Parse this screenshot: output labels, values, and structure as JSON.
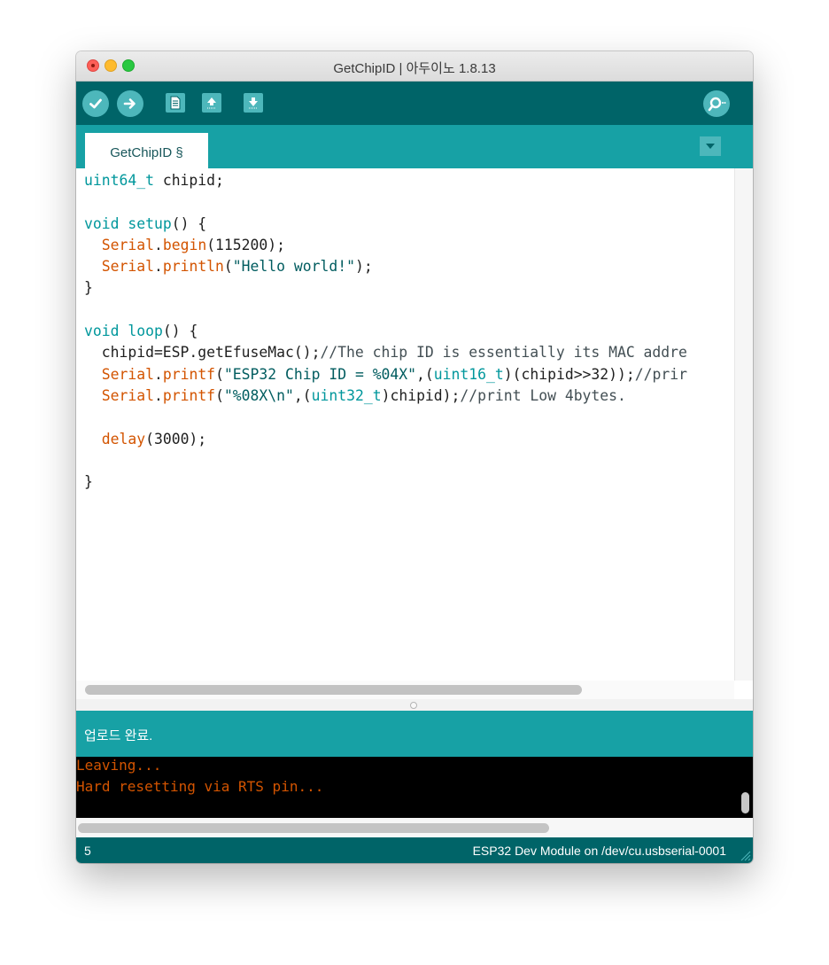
{
  "window": {
    "title": "GetChipID | 아두이노 1.8.13"
  },
  "toolbar": {
    "buttons": [
      {
        "name": "verify",
        "icon": "checkmark-icon"
      },
      {
        "name": "upload",
        "icon": "right-arrow-icon"
      },
      {
        "name": "new",
        "icon": "document-icon"
      },
      {
        "name": "open",
        "icon": "up-arrow-icon"
      },
      {
        "name": "save",
        "icon": "down-arrow-icon"
      },
      {
        "name": "serial-monitor",
        "icon": "magnifier-icon"
      }
    ]
  },
  "tabs": [
    {
      "label": "GetChipID §"
    }
  ],
  "editor": {
    "lines": [
      [
        {
          "t": "uint64_t",
          "c": "kw"
        },
        {
          "t": " chipid;",
          "c": ""
        }
      ],
      [],
      [
        {
          "t": "void",
          "c": "kw"
        },
        {
          "t": " ",
          "c": ""
        },
        {
          "t": "setup",
          "c": "kw"
        },
        {
          "t": "() {",
          "c": ""
        }
      ],
      [
        {
          "t": "  ",
          "c": ""
        },
        {
          "t": "Serial",
          "c": "fn"
        },
        {
          "t": ".",
          "c": ""
        },
        {
          "t": "begin",
          "c": "fn"
        },
        {
          "t": "(115200);",
          "c": ""
        }
      ],
      [
        {
          "t": "  ",
          "c": ""
        },
        {
          "t": "Serial",
          "c": "fn"
        },
        {
          "t": ".",
          "c": ""
        },
        {
          "t": "println",
          "c": "fn"
        },
        {
          "t": "(",
          "c": ""
        },
        {
          "t": "\"Hello world!\"",
          "c": "st"
        },
        {
          "t": ");",
          "c": ""
        }
      ],
      [
        {
          "t": "}",
          "c": ""
        }
      ],
      [],
      [
        {
          "t": "void",
          "c": "kw"
        },
        {
          "t": " ",
          "c": ""
        },
        {
          "t": "loop",
          "c": "kw"
        },
        {
          "t": "() {",
          "c": ""
        }
      ],
      [
        {
          "t": "  chipid=ESP.getEfuseMac();",
          "c": ""
        },
        {
          "t": "//The chip ID is essentially its MAC addre",
          "c": "cm"
        }
      ],
      [
        {
          "t": "  ",
          "c": ""
        },
        {
          "t": "Serial",
          "c": "fn"
        },
        {
          "t": ".",
          "c": ""
        },
        {
          "t": "printf",
          "c": "fn"
        },
        {
          "t": "(",
          "c": ""
        },
        {
          "t": "\"ESP32 Chip ID = %04X\"",
          "c": "st"
        },
        {
          "t": ",(",
          "c": ""
        },
        {
          "t": "uint16_t",
          "c": "kw"
        },
        {
          "t": ")(chipid>>32));",
          "c": ""
        },
        {
          "t": "//prir",
          "c": "cm"
        }
      ],
      [
        {
          "t": "  ",
          "c": ""
        },
        {
          "t": "Serial",
          "c": "fn"
        },
        {
          "t": ".",
          "c": ""
        },
        {
          "t": "printf",
          "c": "fn"
        },
        {
          "t": "(",
          "c": ""
        },
        {
          "t": "\"%08X\\n\"",
          "c": "st"
        },
        {
          "t": ",(",
          "c": ""
        },
        {
          "t": "uint32_t",
          "c": "kw"
        },
        {
          "t": ")chipid);",
          "c": ""
        },
        {
          "t": "//print Low 4bytes.",
          "c": "cm"
        }
      ],
      [],
      [
        {
          "t": "  ",
          "c": ""
        },
        {
          "t": "delay",
          "c": "fn"
        },
        {
          "t": "(3000);",
          "c": ""
        }
      ],
      [],
      [
        {
          "t": "}",
          "c": ""
        }
      ]
    ]
  },
  "status": {
    "message": "업로드 완료."
  },
  "console": {
    "lines": [
      "Leaving...",
      "Hard resetting via RTS pin..."
    ]
  },
  "footer": {
    "line_number": "5",
    "board": "ESP32 Dev Module on /dev/cu.usbserial-0001"
  },
  "colors": {
    "toolbar": "#006468",
    "tabbar": "#17a1a5",
    "button": "#4db7bb",
    "keyword": "#00979c",
    "function": "#d35400",
    "string": "#005c5f",
    "console_text": "#d35400"
  }
}
